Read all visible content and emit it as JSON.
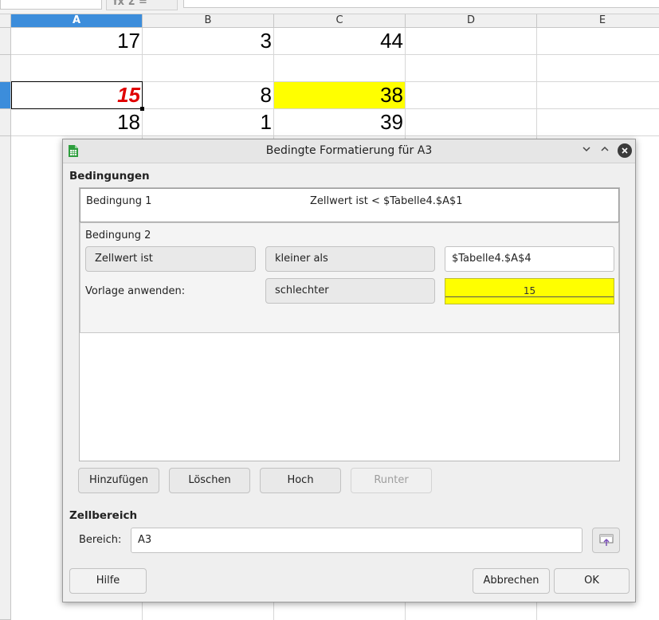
{
  "sheet": {
    "formula_bar": {
      "fx_label": "fx Σ  ="
    },
    "columns": [
      "A",
      "B",
      "C",
      "D",
      "E"
    ],
    "selected_column": "A",
    "rows": [
      {
        "A": "17",
        "B": "3",
        "C": "44"
      },
      {
        "A": "",
        "B": "",
        "C": ""
      },
      {
        "A": "15",
        "B": "8",
        "C": "38"
      },
      {
        "A": "18",
        "B": "1",
        "C": "39"
      }
    ]
  },
  "dialog": {
    "title": "Bedingte Formatierung für A3",
    "conditions_label": "Bedingungen",
    "condition1": {
      "label": "Bedingung 1",
      "description": "Zellwert ist < $Tabelle4.$A$1"
    },
    "condition2": {
      "label": "Bedingung 2",
      "type_value": "Zellwert ist",
      "operator_value": "kleiner als",
      "value": "$Tabelle4.$A$4",
      "apply_style_label": "Vorlage anwenden:",
      "style_value": "schlechter",
      "preview_text": "15"
    },
    "buttons": {
      "add": "Hinzufügen",
      "delete": "Löschen",
      "up": "Hoch",
      "down": "Runter"
    },
    "range_section_label": "Zellbereich",
    "range_label": "Bereich:",
    "range_value": "A3",
    "footer": {
      "help": "Hilfe",
      "cancel": "Abbrechen",
      "ok": "OK"
    },
    "accent_color": "#ffff00"
  }
}
